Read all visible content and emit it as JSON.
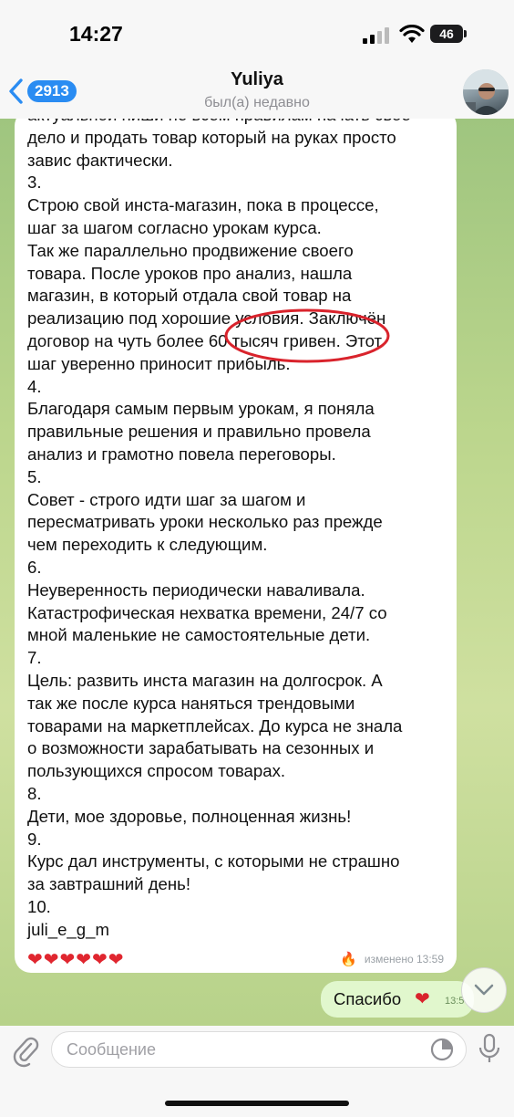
{
  "status_bar": {
    "time": "14:27",
    "battery": "46",
    "icons": [
      "signal-icon",
      "wifi-icon",
      "battery-icon"
    ]
  },
  "header": {
    "back_badge": "2913",
    "contact_name": "Yuliya",
    "contact_status": "был(а) недавно"
  },
  "message": {
    "lines": [
      "актуальной ниши не всем правилам начать свое",
      "дело и продать товар который на руках просто",
      "завис фактически.",
      "3.",
      "Строю свой инста-магазин, пока в процессе,",
      "шаг за шагом согласно урокам курса.",
      "Так же параллельно продвижение своего",
      "товара. После уроков про анализ, нашла",
      "магазин, в который отдала свой товар на",
      "реализацию под хорошие условия. Заключён",
      "договор на чуть более 60 тысяч гривен. Этот",
      "шаг уверенно приносит прибыль.",
      "4.",
      "Благодаря самым первым урокам, я поняла",
      "правильные решения и правильно провела",
      "анализ и грамотно повела переговоры.",
      "5.",
      "Совет - строго идти шаг за шагом и",
      "пересматривать уроки несколько раз прежде",
      "чем переходить к следующим.",
      "6.",
      "Неуверенность периодически наваливала.",
      "Катастрофическая нехватка времени, 24/7 со",
      "мной маленькие не самостоятельные дети.",
      "7.",
      "Цель: развить инста магазин на долгосрок. А",
      "так же после курса наняться трендовыми",
      "товарами на маркетплейсах. До курса не знала",
      "о возможности зарабатывать на сезонных и",
      "пользующихся спросом товарах.",
      "8.",
      "Дети, мое здоровье, полноценная жизнь!",
      "9.",
      "Курс дал инструменты, с которыми не страшно",
      "за завтрашний день!",
      "10.",
      "juli_e_g_m"
    ],
    "hearts": "❤❤❤❤❤❤",
    "reaction": "🔥",
    "edited_time": "изменено 13:59"
  },
  "outgoing": {
    "text": "Спасибо",
    "heart": "❤",
    "time": "13:5"
  },
  "input": {
    "placeholder": "Сообщение"
  },
  "colors": {
    "accent": "#2a8cf2",
    "highlight_ellipse": "#d9232c",
    "chat_background": "#b7d28a",
    "outgoing_bubble": "#e1f7cd"
  }
}
